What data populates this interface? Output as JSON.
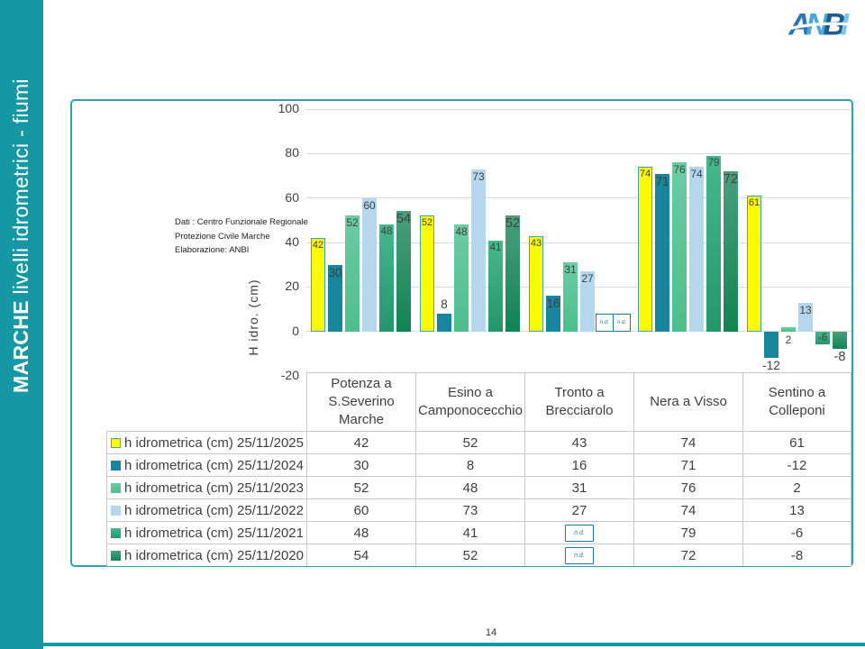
{
  "page": {
    "number": "14"
  },
  "sidebar": {
    "title_bold": "MARCHE",
    "title_rest": " livelli idrometrici - fiumi",
    "bg_color": "#1598A3"
  },
  "logo": {
    "text": "ANBI",
    "letter_colors": [
      "#2E75B6",
      "#4BA6DC",
      "#1F5C8F",
      "#7FC4EA"
    ]
  },
  "chart_note": {
    "lines": [
      "Dati : Centro Funzionale Regionale",
      "Protezione Civile Marche",
      "Elaborazione: ANBI"
    ]
  },
  "chart_data": {
    "type": "bar",
    "title": "",
    "xlabel": "",
    "ylabel": "H idro. (cm)",
    "ylim": [
      -20,
      100
    ],
    "yticks": [
      100,
      80,
      60,
      40,
      20,
      0,
      -20
    ],
    "grid": true,
    "legend_position": "table-left",
    "nd_label": "n.d.",
    "categories": [
      "Potenza a S.Severino Marche",
      "Esino a Camponocecchio",
      "Tronto a Brecciarolo",
      "Nera a Visso",
      "Sentino a Colleponi"
    ],
    "series": [
      {
        "name": "h idrometrica (cm) 25/11/2025",
        "color": "#FCFC00",
        "border": "#41A0C8",
        "label_size": 11,
        "values": [
          42,
          52,
          43,
          74,
          61
        ]
      },
      {
        "name": "h idrometrica (cm) 25/11/2024",
        "color": "#17859B",
        "label_size": 13.5,
        "values": [
          30,
          8,
          16,
          71,
          -12
        ]
      },
      {
        "name": "h idrometrica (cm) 25/11/2023",
        "color": "#6BCCA3",
        "color2": "#4DBE8D",
        "label_size": 12,
        "values": [
          52,
          48,
          31,
          76,
          2
        ]
      },
      {
        "name": "h idrometrica (cm) 25/11/2022",
        "color": "#B5D7ED",
        "label_size": 12,
        "values": [
          60,
          73,
          27,
          74,
          13
        ]
      },
      {
        "name": "h idrometrica (cm) 25/11/2021",
        "color": "#46B88D",
        "color2": "#23966B",
        "label_size": 11.5,
        "values": [
          48,
          41,
          null,
          79,
          -6
        ]
      },
      {
        "name": "h idrometrica (cm) 25/11/2020",
        "color": "#4C9E7C",
        "color2": "#118355",
        "label_size": 14.5,
        "values": [
          54,
          52,
          null,
          72,
          -8
        ]
      }
    ]
  },
  "colors": {
    "accent_teal": "#1598A3",
    "frame_border": "#2FA3B4",
    "gridline": "#D9D9D9",
    "bar_label": "#404040",
    "nd_text": "#2E75B6",
    "table_border": "#C9C9C9"
  }
}
